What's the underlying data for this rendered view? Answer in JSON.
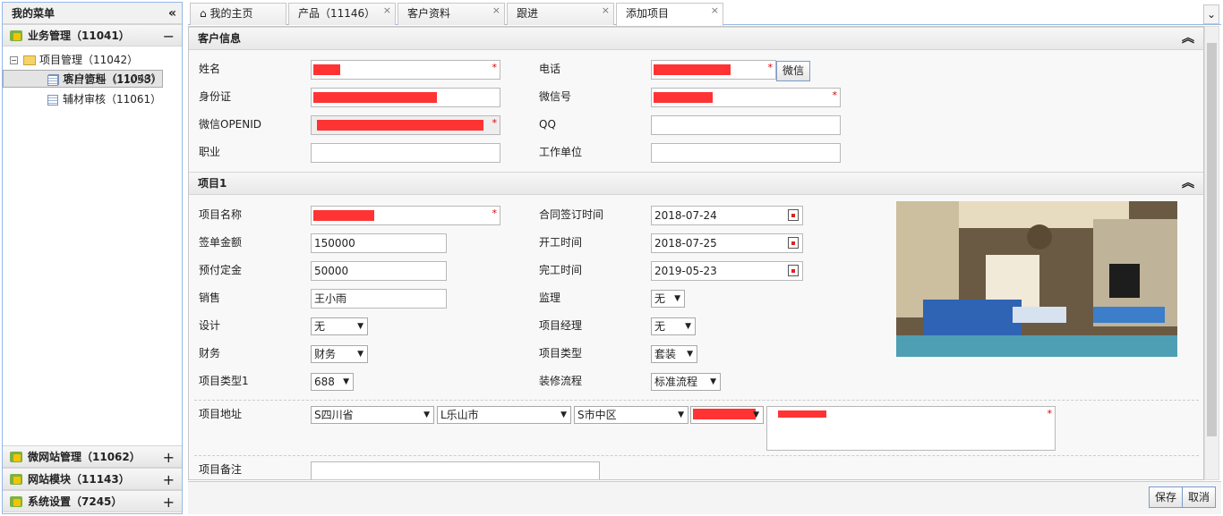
{
  "sidebar": {
    "title": "我的菜单",
    "collapse": "«",
    "groups": [
      {
        "label": "业务管理（11041）",
        "toggle": "−"
      },
      {
        "label": "微网站管理（11062）",
        "toggle": "+"
      },
      {
        "label": "网站模块（11143）",
        "toggle": "+"
      },
      {
        "label": "系统设置（7245）",
        "toggle": "+"
      }
    ],
    "tree": {
      "root": "项目管理（11042）",
      "toggle": "−",
      "children": [
        "客户资料（11043）",
        "项目管理（11058）",
        "辅材审核（11061）"
      ]
    }
  },
  "tabs": [
    {
      "label": "我的主页"
    },
    {
      "label": "产品（11146）"
    },
    {
      "label": "客户资料"
    },
    {
      "label": "跟进"
    },
    {
      "label": "添加项目"
    }
  ],
  "tab_close": "×",
  "tab_menu": "⌄",
  "customer": {
    "title": "客户信息",
    "collapse": "︽",
    "name_label": "姓名",
    "phone_label": "电话",
    "wechat_button": "微信",
    "idcard_label": "身份证",
    "wechat_no_label": "微信号",
    "openid_label": "微信OPENID",
    "qq_label": "QQ",
    "job_label": "职业",
    "company_label": "工作单位",
    "required_mark": "*"
  },
  "project": {
    "title": "项目1",
    "collapse": "︽",
    "name_label": "项目名称",
    "contract_date_label": "合同签订时间",
    "contract_date": "2018-07-24",
    "amount_label": "签单金额",
    "amount": "150000",
    "start_label": "开工时间",
    "start": "2018-07-25",
    "deposit_label": "预付定金",
    "deposit": "50000",
    "finish_label": "完工时间",
    "finish": "2019-05-23",
    "sales_label": "销售",
    "sales": "王小雨",
    "supervisor_label": "监理",
    "supervisor": "无",
    "design_label": "设计",
    "design": "无",
    "pm_label": "项目经理",
    "pm": "无",
    "finance_label": "财务",
    "finance": "财务",
    "type_label": "项目类型",
    "type": "套装",
    "type1_label": "项目类型1",
    "type1": "688",
    "flow_label": "装修流程",
    "flow": "标准流程",
    "address_label": "项目地址",
    "province": "S四川省",
    "city": "L乐山市",
    "district": "S市中区",
    "remark_label": "项目备注",
    "arrow": "▼"
  },
  "footer": {
    "save": "保存",
    "cancel": "取消"
  },
  "colors": {
    "accent_border": "#95b8e7",
    "redaction": "#ff3333"
  }
}
